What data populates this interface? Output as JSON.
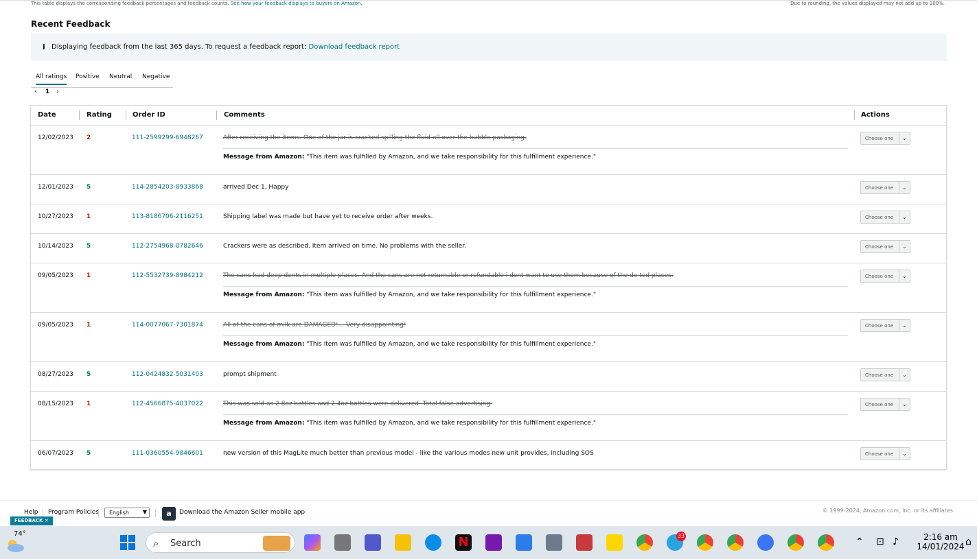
{
  "top_note": {
    "left_text": "This table displays the corresponding feedback percentages and feedback counts.",
    "left_link": "See how your feedback displays to buyers on Amazon.",
    "right_text": "Due to rounding, the values displayed may not add up to 100%."
  },
  "section_title": "Recent Feedback",
  "info": {
    "icon": "i",
    "text": "Displaying feedback from the last 365 days. To request a feedback report:",
    "link": "Download feedback report"
  },
  "tabs": [
    "All ratings",
    "Positive",
    "Neutral",
    "Negative"
  ],
  "pager": {
    "prev": "‹",
    "page": "1",
    "next": "›"
  },
  "table": {
    "headers": {
      "date": "Date",
      "rating": "Rating",
      "order": "Order ID",
      "comments": "Comments",
      "actions": "Actions"
    },
    "select_label": "Choose one",
    "message_label": "Message from Amazon:",
    "message_text": "\"This item was fulfilled by Amazon, and we take responsibility for this fulfillment experience.\"",
    "rows": [
      {
        "date": "12/02/2023",
        "rating": "2",
        "order": "111-2599299-6948267",
        "comment": "After receiving the items. One of the jar is cracked spilling the fluid all over the bubble packaging.",
        "struck": true
      },
      {
        "date": "12/01/2023",
        "rating": "5",
        "order": "114-2854203-8933868",
        "comment": "arrived Dec 1, Happy",
        "struck": false
      },
      {
        "date": "10/27/2023",
        "rating": "1",
        "order": "113-8186706-2116251",
        "comment": "Shipping label was made but have yet to receive order after weeks.",
        "struck": false
      },
      {
        "date": "10/14/2023",
        "rating": "5",
        "order": "112-2754968-0782646",
        "comment": "Crackers were as described. Item arrived on time. No problems with the seller.",
        "struck": false
      },
      {
        "date": "09/05/2023",
        "rating": "1",
        "order": "112-5532739-8984212",
        "comment": "The cans had deep dents in multiple places. And the cans are not returnable or refundable i dont want to use them because of the de ted places.",
        "struck": true
      },
      {
        "date": "09/05/2023",
        "rating": "1",
        "order": "114-0077067-7301874",
        "comment": "All of the cans of milk are DAMAGED!... Very disappointing!",
        "struck": true
      },
      {
        "date": "08/27/2023",
        "rating": "5",
        "order": "112-0424832-5031403",
        "comment": "prompt shipment",
        "struck": false
      },
      {
        "date": "08/15/2023",
        "rating": "1",
        "order": "112-4566875-4037022",
        "comment": "This was sold as 2 8oz bottles and 2 4oz bottles were delivered. Total false advertising.",
        "struck": true
      },
      {
        "date": "06/07/2023",
        "rating": "5",
        "order": "111-0360554-9846601",
        "comment": "new version of this MagLite much better than previous model - like the various modes new unit provides, including SOS",
        "struck": false
      }
    ]
  },
  "colors": {
    "link": "#007185",
    "positive": "#067d62",
    "negative": "#b12704"
  },
  "footer": {
    "help": "Help",
    "policies": "Program Policies",
    "language": "English",
    "app_icon": "a",
    "app_text": "Download the Amazon Seller mobile app",
    "copyright": "© 1999-2024, Amazon.com, Inc. or its affiliates"
  },
  "feedback_tab": "FEEDBACK ✕",
  "taskbar": {
    "temperature": "74°",
    "search_placeholder": "Search",
    "telegram_badge": "33",
    "time": "2:16 am",
    "date": "14/01/2024",
    "icons": [
      "start-icon",
      "search-icon",
      "widgets-icon",
      "copilot-icon",
      "task-view-icon",
      "teams-icon",
      "file-explorer-icon",
      "edge-icon",
      "netflix-icon",
      "onenote-icon",
      "notepad-icon",
      "calculator-icon",
      "snipping-tool-icon",
      "sticky-notes-icon",
      "chrome-icon",
      "telegram-icon",
      "chrome-profile-icon",
      "chrome-profile-2-icon",
      "signal-icon",
      "chrome-profile-3-icon",
      "chrome-profile-4-icon"
    ]
  }
}
